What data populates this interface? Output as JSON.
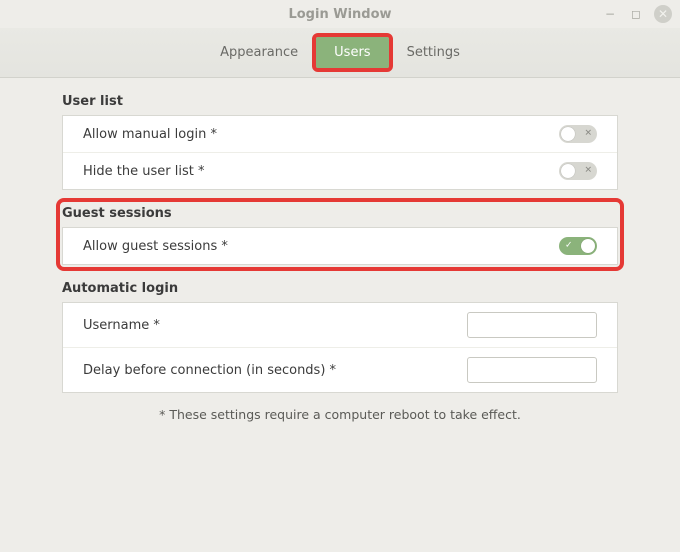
{
  "window": {
    "title": "Login Window"
  },
  "tabs": {
    "appearance": "Appearance",
    "users": "Users",
    "settings": "Settings",
    "active": "users"
  },
  "user_list": {
    "title": "User list",
    "allow_manual_login": {
      "label": "Allow manual login *",
      "value": false
    },
    "hide_user_list": {
      "label": "Hide the user list *",
      "value": false
    }
  },
  "guest_sessions": {
    "title": "Guest sessions",
    "allow_guest_sessions": {
      "label": "Allow guest sessions *",
      "value": true
    }
  },
  "automatic_login": {
    "title": "Automatic login",
    "username": {
      "label": "Username *",
      "value": ""
    },
    "delay": {
      "label": "Delay before connection (in seconds) *",
      "value": ""
    }
  },
  "footer_note": "* These settings require a computer reboot to take effect.",
  "highlight": {
    "tab_users": true,
    "section_guest": true
  }
}
